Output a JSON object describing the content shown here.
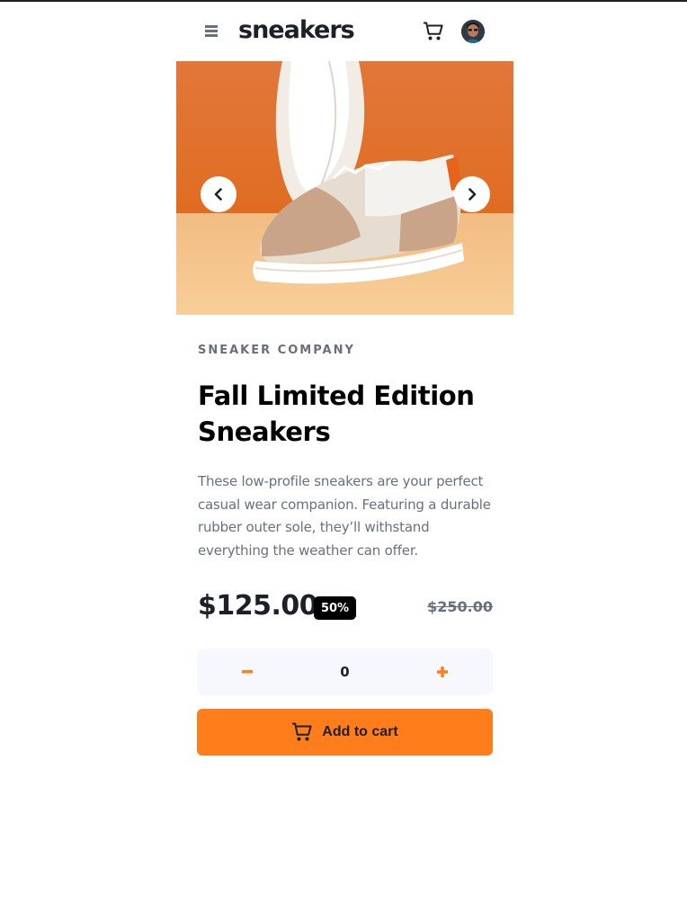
{
  "header": {
    "logo": "sneakers",
    "menu_icon": "hamburger-menu-icon",
    "cart_icon": "shopping-cart-icon",
    "avatar_icon": "user-avatar"
  },
  "gallery": {
    "prev_icon": "chevron-left-icon",
    "next_icon": "chevron-right-icon"
  },
  "product": {
    "company": "SNEAKER COMPANY",
    "title": "Fall Limited Edition Sneakers",
    "description": "These low-profile sneakers are your perfect casual wear companion. Featuring a durable rubber outer sole, they’ll withstand everything the weather can offer.",
    "price": "$125.00",
    "discount": "50%",
    "original_price": "$250.00"
  },
  "quantity": {
    "value": "0",
    "minus_icon": "minus-icon",
    "plus_icon": "plus-icon"
  },
  "cart_button": {
    "label": "Add to cart",
    "icon": "shopping-cart-icon"
  },
  "colors": {
    "accent": "#ff7e1b",
    "text_dark": "#1d2026",
    "text_muted": "#69707d",
    "qty_bg": "#f6f8fd"
  }
}
